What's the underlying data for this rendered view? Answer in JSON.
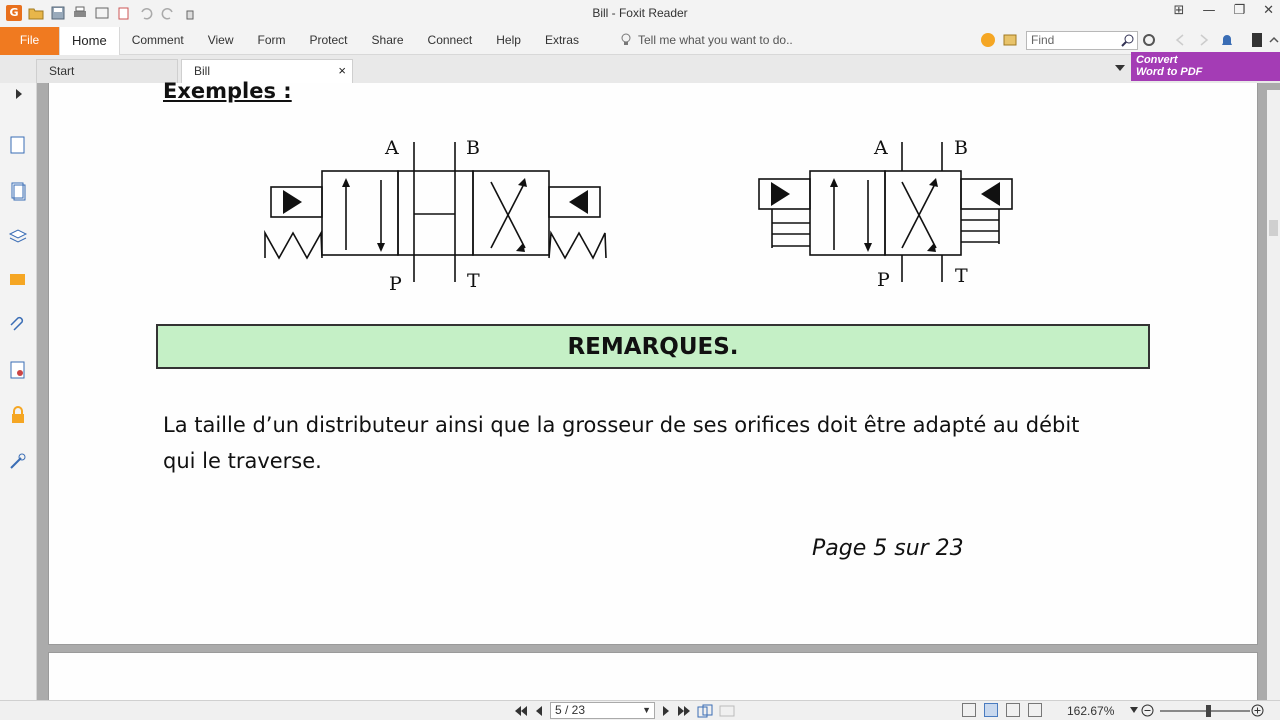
{
  "window": {
    "title": "Bill - Foxit Reader",
    "min": "—",
    "max": "❐",
    "close": "✕"
  },
  "ribbon": {
    "file": "File",
    "tabs": [
      "Home",
      "Comment",
      "View",
      "Form",
      "Protect",
      "Share",
      "Connect",
      "Help",
      "Extras"
    ],
    "tellme": "Tell me what you want to do..",
    "find_placeholder": "Find"
  },
  "doc_tabs": {
    "start": "Start",
    "bill": "Bill",
    "close": "×"
  },
  "convert": {
    "line1": "Convert",
    "line2": "Word to PDF"
  },
  "document": {
    "heading": "Exemples :",
    "diagram1": {
      "a": "A",
      "b": "B",
      "p": "P",
      "t": "T"
    },
    "diagram2": {
      "a": "A",
      "b": "B",
      "p": "P",
      "t": "T"
    },
    "remarques": "REMARQUES.",
    "paragraph_line1": "La taille d’un distributeur ainsi que la grosseur de ses orifices doit être adapté au débit",
    "paragraph_line2": "qui le traverse.",
    "page_footer": "Page 5 sur 23"
  },
  "status": {
    "page_value": "5 / 23",
    "zoom": "162.67%"
  },
  "colors": {
    "accent": "#f07a20",
    "remarques_bg": "#c5f0c6",
    "convert_bg": "#a43cb5"
  }
}
